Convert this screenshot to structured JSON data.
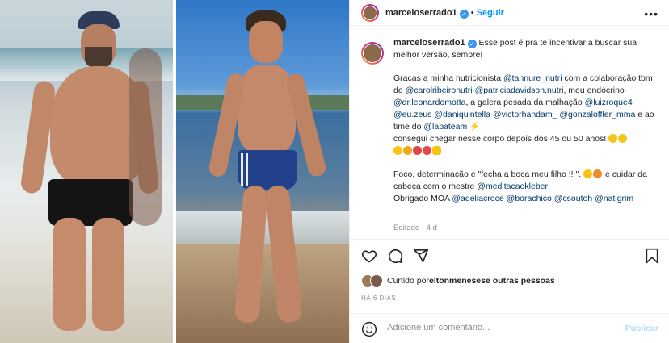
{
  "post": {
    "username": "marceloserrado1",
    "follow_label": "Seguir",
    "more_label": "•••"
  },
  "caption": {
    "username": "marceloserrado1",
    "line1": "Esse post é pra te incentivar a buscar sua melhor versão, sempre!",
    "p2_a": "Graças a minha nutricionista ",
    "m_tannure": "@tannure_nutri",
    "p2_b": " com a colaboração tbm de ",
    "m_carol": "@carolribeironutri",
    "m_patricia": "@patriciadavidson.nutri",
    "p2_c": ", meu endócrino ",
    "m_leonardo": "@dr.leonardomotta",
    "p2_d": ", a galera pesada da malhação ",
    "m_luiz": "@luizroque4",
    "m_zeus": "@eu.zeus",
    "m_dani": "@daniquintella",
    "m_victor": "@victorhandam_",
    "m_gonzalo": "@gonzaloffler_mma",
    "p2_e": " e ao time do ",
    "m_lapa": "@lapateam",
    "p2_f": "consegui chegar nesse corpo depois dos 45 ou 50 anos!",
    "p3_a": "Foco, determinação e \"fecha a boca meu filho !! \".",
    "p3_b": " e cuidar da cabeça com o mestre ",
    "m_medita": "@meditacaokleber",
    "p3_c": "Obrigado MOA ",
    "m_adelia": "@adeliacroce",
    "m_bora": "@borachico",
    "m_csoutoh": "@csoutoh",
    "m_natigrim": "@natigrim",
    "edited": "Editado · 4 d"
  },
  "likes": {
    "prefix": "Curtido por ",
    "user": "eltonmeneses",
    "suffix": " e outras pessoas"
  },
  "timestamp": "HÁ 6 DIAS",
  "comment": {
    "placeholder": "Adicione um comentário...",
    "publish_label": "Publicar"
  },
  "colors": {
    "accent": "#0095f6",
    "mention": "#00376b",
    "muted": "#8e8e8e"
  }
}
